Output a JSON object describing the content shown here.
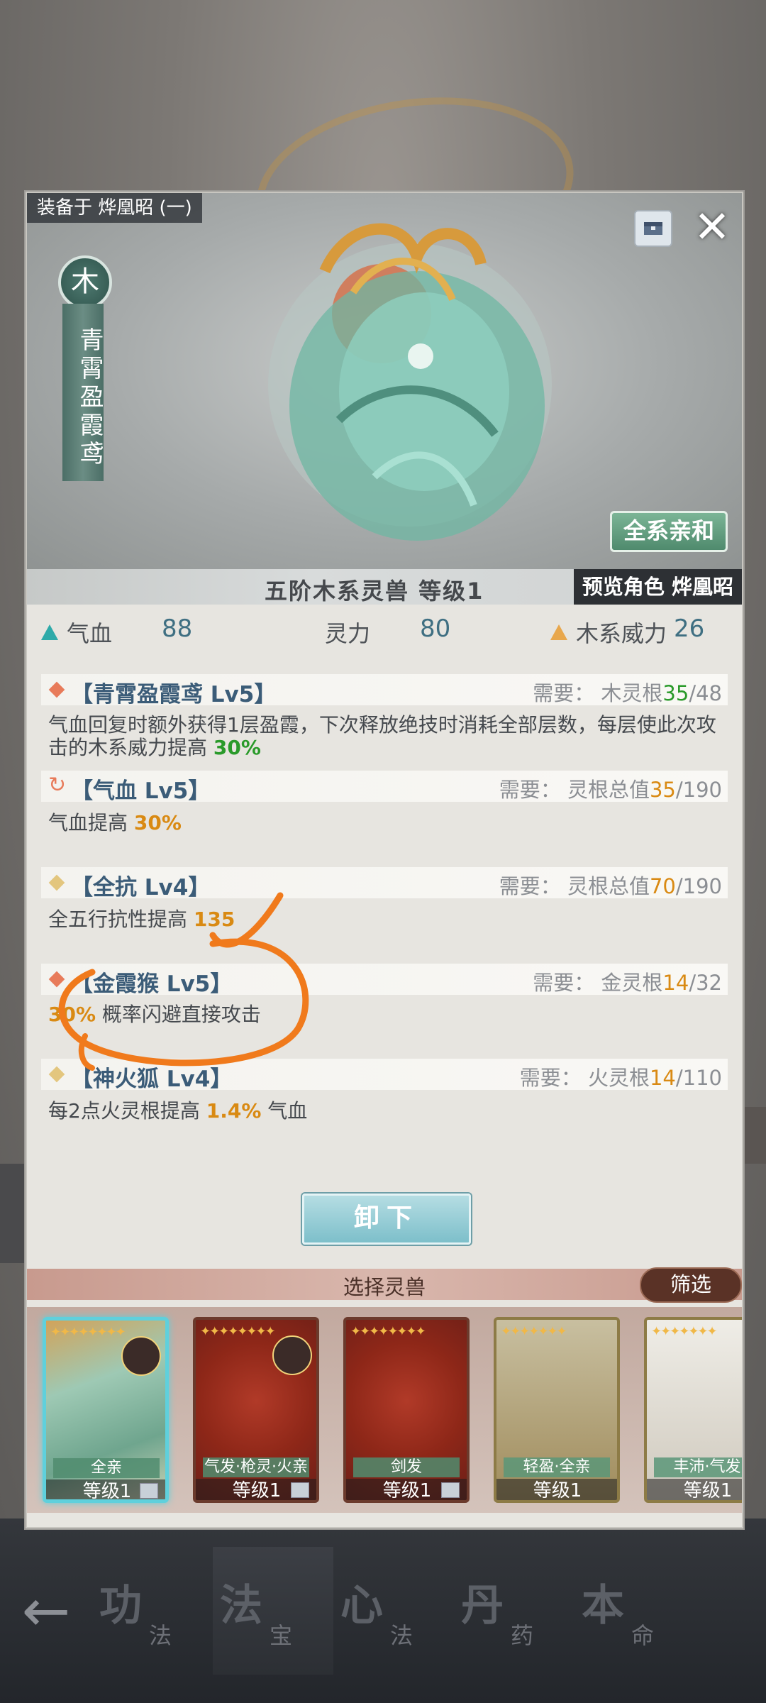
{
  "hero": {
    "equip_label": "装备于 烨凰昭 (一)",
    "element": "木",
    "beast_name": "青霄盈霞鸢",
    "affinity": "全系亲和",
    "tier_level": "五阶木系灵兽   等级1",
    "preview_role": "预览角色 烨凰昭"
  },
  "stats": {
    "hp_label": "气血",
    "hp_value": "88",
    "spirit_label": "灵力",
    "spirit_value": "80",
    "wood_label": "木系威力",
    "wood_value": "26"
  },
  "skills": [
    {
      "name": "【青霄盈霞鸢 Lv5】",
      "req_prefix": "需要：  木灵根",
      "req_cur": "35",
      "req_max": "/48",
      "desc_text": "气血回复时额外获得1层盈霞，下次释放绝技时消耗全部层数，每层使此次攻击的木系威力提高 ",
      "desc_value": "30%"
    },
    {
      "name": "【气血 Lv5】",
      "req_prefix": "需要：  灵根总值",
      "req_cur": "35",
      "req_max": "/190",
      "desc_text": "气血提高 ",
      "desc_value": "30%"
    },
    {
      "name": "【全抗 Lv4】",
      "req_prefix": "需要：  灵根总值",
      "req_cur": "70",
      "req_max": "/190",
      "desc_text": "全五行抗性提高 ",
      "desc_value": "135"
    },
    {
      "name": "【金霞猴 Lv5】",
      "req_prefix": "需要：  金灵根",
      "req_cur": "14",
      "req_max": "/32",
      "desc_value": "30%",
      "desc_text": " 概率闪避直接攻击"
    },
    {
      "name": "【神火狐 Lv4】",
      "req_prefix": "需要：  火灵根",
      "req_cur": "14",
      "req_max": "/110",
      "desc_text": "每2点火灵根提高 ",
      "desc_value": "1.4%",
      "desc_suffix": " 气血"
    }
  ],
  "unequip_label": "卸下",
  "select_title": "选择灵兽",
  "filter_label": "筛选",
  "cards": [
    {
      "tag": "全亲",
      "level": "等级1"
    },
    {
      "tag": "气发·枪灵·火亲",
      "level": "等级1"
    },
    {
      "tag": "剑发",
      "level": "等级1"
    },
    {
      "tag": "轻盈·全亲",
      "level": "等级1"
    },
    {
      "tag": "丰沛·气发",
      "level": "等级1"
    }
  ],
  "nav": {
    "items": [
      {
        "big": "功",
        "small": "法"
      },
      {
        "big": "法",
        "small": "宝"
      },
      {
        "big": "心",
        "small": "法"
      },
      {
        "big": "丹",
        "small": "药"
      },
      {
        "big": "本",
        "small": "命"
      }
    ]
  },
  "colors": {
    "accent_teal": "#2eaaa9",
    "highlight_orange": "#d98a13",
    "highlight_green": "#2a9a2a",
    "annotation": "#f07a1c"
  }
}
